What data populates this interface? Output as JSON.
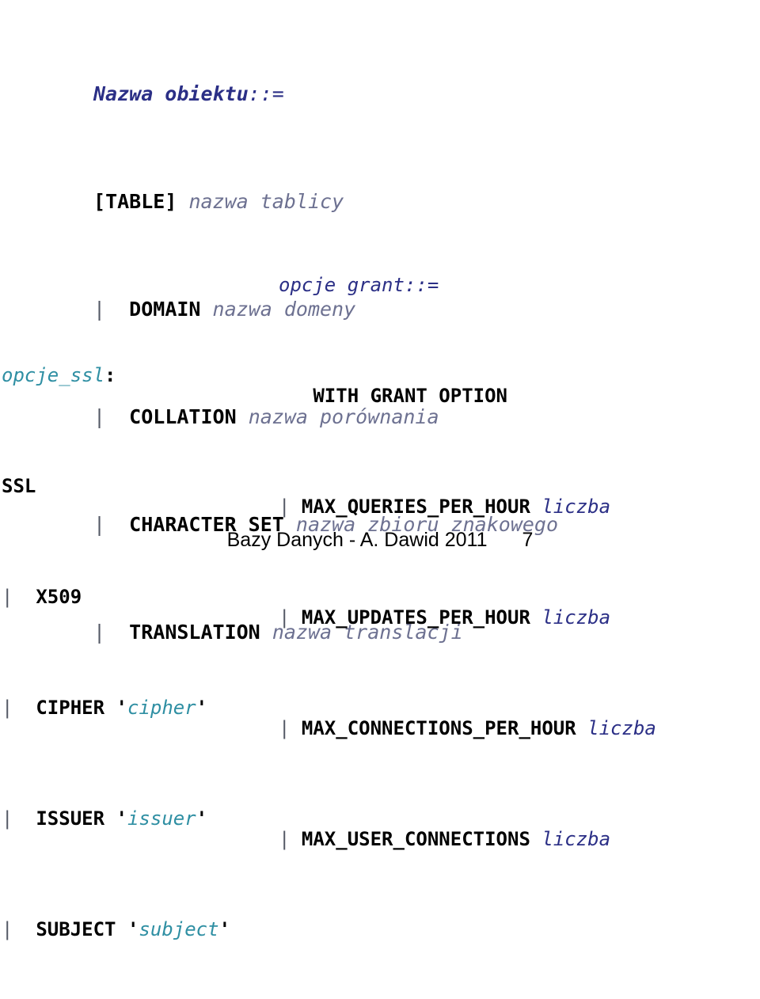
{
  "slide": {
    "footer_text": "Bazy Danych - A. Dawid 2011",
    "page_number": "7"
  },
  "colors": {
    "navy": "#2b2f86",
    "teal": "#2f8fa3",
    "placeholder_grey": "#6d7191",
    "keyword_black": "#000000",
    "background": "#ffffff"
  },
  "block_object": {
    "heading_name": "Nazwa obiektu",
    "heading_assign": "::=",
    "rows": [
      {
        "lead_open": "[",
        "keyword": "TABLE",
        "lead_close": "]",
        "placeholder": "nazwa tablicy"
      },
      {
        "bar": "|",
        "keyword": "DOMAIN",
        "placeholder": "nazwa domeny"
      },
      {
        "bar": "|",
        "keyword": "COLLATION",
        "placeholder": "nazwa porównania"
      },
      {
        "bar": "|",
        "keyword": "CHARACTER SET",
        "placeholder": "nazwa zbioru znakowego"
      },
      {
        "bar": "|",
        "keyword": "TRANSLATION",
        "placeholder": "nazwa translacji"
      }
    ]
  },
  "block_ssl": {
    "heading_name": "opcje_ssl",
    "heading_colon": ":",
    "rows": [
      {
        "bar": "",
        "keyword": "SSL",
        "quote_open": "",
        "placeholder": "",
        "quote_close": ""
      },
      {
        "bar": "|",
        "keyword": "X509",
        "quote_open": "",
        "placeholder": "",
        "quote_close": ""
      },
      {
        "bar": "|",
        "keyword": "CIPHER",
        "quote_open": "'",
        "placeholder": "cipher",
        "quote_close": "'"
      },
      {
        "bar": "|",
        "keyword": "ISSUER",
        "quote_open": "'",
        "placeholder": "issuer",
        "quote_close": "'"
      },
      {
        "bar": "|",
        "keyword": "SUBJECT",
        "quote_open": "'",
        "placeholder": "subject",
        "quote_close": "'"
      }
    ]
  },
  "block_grant": {
    "heading_name": "opcje grant",
    "heading_assign": "::=",
    "rows": [
      {
        "bar": "",
        "keyword": "WITH GRANT OPTION",
        "placeholder": ""
      },
      {
        "bar": "|",
        "keyword": "MAX_QUERIES_PER_HOUR",
        "placeholder": "liczba"
      },
      {
        "bar": "|",
        "keyword": "MAX_UPDATES_PER_HOUR",
        "placeholder": "liczba"
      },
      {
        "bar": "|",
        "keyword": "MAX_CONNECTIONS_PER_HOUR",
        "placeholder": "liczba"
      },
      {
        "bar": "|",
        "keyword": "MAX_USER_CONNECTIONS",
        "placeholder": "liczba"
      }
    ]
  }
}
